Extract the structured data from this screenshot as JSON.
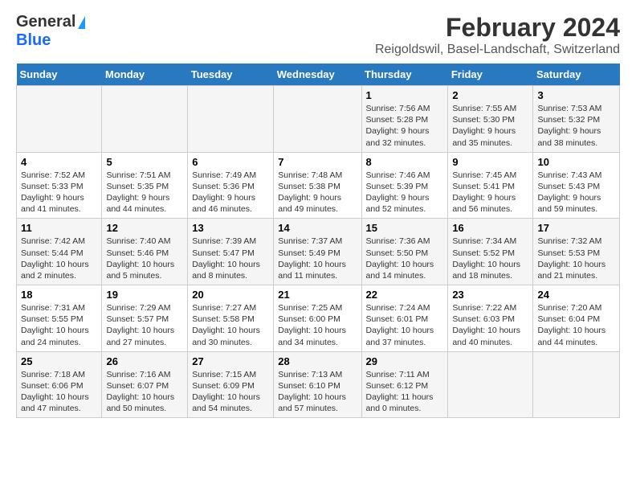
{
  "logo": {
    "general": "General",
    "blue": "Blue"
  },
  "title": "February 2024",
  "subtitle": "Reigoldswil, Basel-Landschaft, Switzerland",
  "weekdays": [
    "Sunday",
    "Monday",
    "Tuesday",
    "Wednesday",
    "Thursday",
    "Friday",
    "Saturday"
  ],
  "weeks": [
    [
      {
        "num": "",
        "info": ""
      },
      {
        "num": "",
        "info": ""
      },
      {
        "num": "",
        "info": ""
      },
      {
        "num": "",
        "info": ""
      },
      {
        "num": "1",
        "info": "Sunrise: 7:56 AM\nSunset: 5:28 PM\nDaylight: 9 hours and 32 minutes."
      },
      {
        "num": "2",
        "info": "Sunrise: 7:55 AM\nSunset: 5:30 PM\nDaylight: 9 hours and 35 minutes."
      },
      {
        "num": "3",
        "info": "Sunrise: 7:53 AM\nSunset: 5:32 PM\nDaylight: 9 hours and 38 minutes."
      }
    ],
    [
      {
        "num": "4",
        "info": "Sunrise: 7:52 AM\nSunset: 5:33 PM\nDaylight: 9 hours and 41 minutes."
      },
      {
        "num": "5",
        "info": "Sunrise: 7:51 AM\nSunset: 5:35 PM\nDaylight: 9 hours and 44 minutes."
      },
      {
        "num": "6",
        "info": "Sunrise: 7:49 AM\nSunset: 5:36 PM\nDaylight: 9 hours and 46 minutes."
      },
      {
        "num": "7",
        "info": "Sunrise: 7:48 AM\nSunset: 5:38 PM\nDaylight: 9 hours and 49 minutes."
      },
      {
        "num": "8",
        "info": "Sunrise: 7:46 AM\nSunset: 5:39 PM\nDaylight: 9 hours and 52 minutes."
      },
      {
        "num": "9",
        "info": "Sunrise: 7:45 AM\nSunset: 5:41 PM\nDaylight: 9 hours and 56 minutes."
      },
      {
        "num": "10",
        "info": "Sunrise: 7:43 AM\nSunset: 5:43 PM\nDaylight: 9 hours and 59 minutes."
      }
    ],
    [
      {
        "num": "11",
        "info": "Sunrise: 7:42 AM\nSunset: 5:44 PM\nDaylight: 10 hours and 2 minutes."
      },
      {
        "num": "12",
        "info": "Sunrise: 7:40 AM\nSunset: 5:46 PM\nDaylight: 10 hours and 5 minutes."
      },
      {
        "num": "13",
        "info": "Sunrise: 7:39 AM\nSunset: 5:47 PM\nDaylight: 10 hours and 8 minutes."
      },
      {
        "num": "14",
        "info": "Sunrise: 7:37 AM\nSunset: 5:49 PM\nDaylight: 10 hours and 11 minutes."
      },
      {
        "num": "15",
        "info": "Sunrise: 7:36 AM\nSunset: 5:50 PM\nDaylight: 10 hours and 14 minutes."
      },
      {
        "num": "16",
        "info": "Sunrise: 7:34 AM\nSunset: 5:52 PM\nDaylight: 10 hours and 18 minutes."
      },
      {
        "num": "17",
        "info": "Sunrise: 7:32 AM\nSunset: 5:53 PM\nDaylight: 10 hours and 21 minutes."
      }
    ],
    [
      {
        "num": "18",
        "info": "Sunrise: 7:31 AM\nSunset: 5:55 PM\nDaylight: 10 hours and 24 minutes."
      },
      {
        "num": "19",
        "info": "Sunrise: 7:29 AM\nSunset: 5:57 PM\nDaylight: 10 hours and 27 minutes."
      },
      {
        "num": "20",
        "info": "Sunrise: 7:27 AM\nSunset: 5:58 PM\nDaylight: 10 hours and 30 minutes."
      },
      {
        "num": "21",
        "info": "Sunrise: 7:25 AM\nSunset: 6:00 PM\nDaylight: 10 hours and 34 minutes."
      },
      {
        "num": "22",
        "info": "Sunrise: 7:24 AM\nSunset: 6:01 PM\nDaylight: 10 hours and 37 minutes."
      },
      {
        "num": "23",
        "info": "Sunrise: 7:22 AM\nSunset: 6:03 PM\nDaylight: 10 hours and 40 minutes."
      },
      {
        "num": "24",
        "info": "Sunrise: 7:20 AM\nSunset: 6:04 PM\nDaylight: 10 hours and 44 minutes."
      }
    ],
    [
      {
        "num": "25",
        "info": "Sunrise: 7:18 AM\nSunset: 6:06 PM\nDaylight: 10 hours and 47 minutes."
      },
      {
        "num": "26",
        "info": "Sunrise: 7:16 AM\nSunset: 6:07 PM\nDaylight: 10 hours and 50 minutes."
      },
      {
        "num": "27",
        "info": "Sunrise: 7:15 AM\nSunset: 6:09 PM\nDaylight: 10 hours and 54 minutes."
      },
      {
        "num": "28",
        "info": "Sunrise: 7:13 AM\nSunset: 6:10 PM\nDaylight: 10 hours and 57 minutes."
      },
      {
        "num": "29",
        "info": "Sunrise: 7:11 AM\nSunset: 6:12 PM\nDaylight: 11 hours and 0 minutes."
      },
      {
        "num": "",
        "info": ""
      },
      {
        "num": "",
        "info": ""
      }
    ]
  ]
}
